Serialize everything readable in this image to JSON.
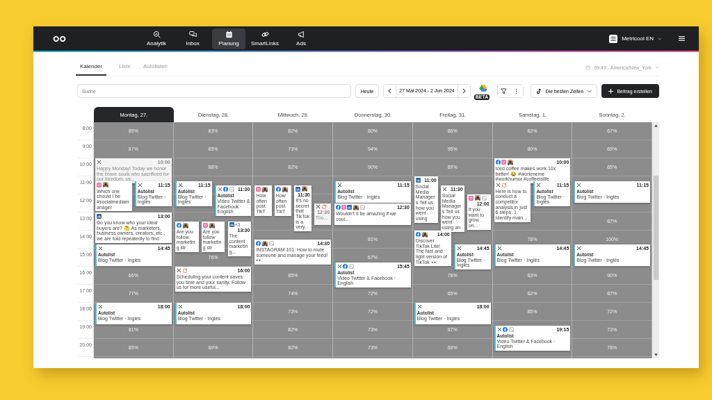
{
  "nav": [
    {
      "label": "Analytik",
      "kind": "analytics",
      "selected": false
    },
    {
      "label": "Inbox",
      "kind": "chat",
      "selected": false
    },
    {
      "label": "Planung",
      "kind": "calendar",
      "selected": true
    },
    {
      "label": "SmartLinks",
      "kind": "link",
      "selected": false
    },
    {
      "label": "Ads",
      "kind": "megaphone",
      "selected": false
    }
  ],
  "account": {
    "name": "Metricool EN"
  },
  "tabs": [
    {
      "label": "Kalender",
      "selected": true
    },
    {
      "label": "Liste",
      "selected": false
    },
    {
      "label": "Autolisten",
      "selected": false
    }
  ],
  "clock": "09:49 - America/New_York",
  "search": {
    "placeholder": "Suche"
  },
  "today_button": "Heute",
  "date_range": "27 Mai 2024 - 2 Jun 2024",
  "beta_badge": "BETA",
  "best_times": "Die besten Zeiten",
  "create_button": "Beitrag erstellen",
  "hours": [
    "8:00",
    "9:00",
    "10:00",
    "11:00",
    "12:00",
    "13:00",
    "14:00",
    "15:00",
    "16:00",
    "17:00",
    "18:00",
    "19:00",
    "20:00"
  ],
  "days": [
    {
      "label": "Montag, 27.",
      "selected": true,
      "heat": [
        {
          "value": "85%"
        },
        {
          "value": "87%"
        },
        {
          "covered": true
        },
        {
          "covered": true
        },
        {
          "covered": true
        },
        {
          "covered": true
        },
        {
          "covered": true
        },
        {
          "covered": true
        },
        {
          "value": "66%"
        },
        {
          "value": "77%"
        },
        {
          "covered": true
        },
        {
          "value": "81%"
        },
        {
          "value": "85%"
        }
      ],
      "posts": [
        {
          "networks": [
            {
              "kind": "x"
            }
          ],
          "time": "10:00",
          "text": "Happy Monday! Today we honor the brave souls who sacrificed for our freedom. us...",
          "past": true
        },
        {
          "networks": [
            {
              "kind": "instagram"
            }
          ],
          "text": "Which one should I be #socialmediamanager",
          "thumb": true,
          "past": false
        },
        {
          "networks": [
            {
              "kind": "x"
            }
          ],
          "time": "11:15",
          "autolist": "Autolist",
          "text": "Blog Twitter · Inglés",
          "past": false
        },
        {
          "networks": [
            {
              "kind": "linkedin"
            }
          ],
          "time": "13:00",
          "text": "Do you know who your ideal buyers are? 🤔 As marketers, business owners, creators, etc., we are told repeatedly to find",
          "past": false
        },
        {
          "networks": [
            {
              "kind": "x"
            }
          ],
          "time": "14:45",
          "autolist": "Autolist",
          "text": "Blog Twitter · Inglés",
          "past": false
        },
        {
          "networks": [
            {
              "kind": "x"
            }
          ],
          "time": "18:00",
          "autolist": "Autolist",
          "text": "Blog Twitter · Inglés",
          "past": false
        }
      ]
    },
    {
      "label": "Dienstag, 28.",
      "selected": false,
      "heat": [
        {
          "value": "83%"
        },
        {
          "value": "85%"
        },
        {
          "value": "88%"
        },
        {
          "covered": true
        },
        {
          "covered": true
        },
        {
          "covered": true
        },
        {
          "covered": true
        },
        {
          "value": "76%"
        },
        {
          "covered": true
        },
        {
          "covered": true
        },
        {
          "covered": true
        },
        {
          "covered": true
        },
        {
          "value": "60%"
        }
      ],
      "posts": [
        {
          "networks": [
            {
              "kind": "x"
            }
          ],
          "time": "11:15",
          "autolist": "Autolist",
          "text": "Blog Twitter · Inglés",
          "past": false
        },
        {
          "networks": [
            {
              "kind": "x"
            },
            {
              "kind": "facebook"
            }
          ],
          "time": "11:30",
          "autolist": "Autolist",
          "text": "Video Twitter & Facebook · English",
          "footer": {
            "kind": "grid"
          },
          "past": false
        },
        {
          "networks": [
            {
              "kind": "facebook"
            }
          ],
          "text": "Are you follow marketing str",
          "thumb": true,
          "past": false
        },
        {
          "networks": [
            {
              "kind": "instagram"
            }
          ],
          "text": "Are you follow marketing str",
          "thumb": true,
          "past": false
        },
        {
          "networks": [
            {
              "kind": "linkedin"
            }
          ],
          "time": "13:30",
          "text": "The content marketing...",
          "extra": "+3",
          "past": false
        },
        {
          "networks": [
            {
              "kind": "x"
            }
          ],
          "time": "16:00",
          "text": "Scheduling your content saves you time and your sanity. Follow us for more useful...",
          "footer": {
            "kind": "edit"
          },
          "past": false
        },
        {
          "networks": [
            {
              "kind": "x"
            }
          ],
          "time": "18:00",
          "autolist": "Autolist",
          "text": "Blog Twitter · Inglés",
          "past": false
        }
      ]
    },
    {
      "label": "Mittwoch, 29.",
      "selected": false,
      "heat": [
        {
          "value": "82%"
        },
        {
          "value": "73%"
        },
        {
          "value": "82%"
        },
        {
          "covered": true
        },
        {
          "covered": true
        },
        {
          "covered": true
        },
        {
          "covered": true
        },
        {
          "covered": true
        },
        {
          "value": "85%"
        },
        {
          "value": "74%"
        },
        {
          "value": "73%"
        },
        {
          "value": "82%"
        },
        {
          "value": "82%"
        }
      ],
      "posts": [
        {
          "networks": [
            {
              "kind": "instagram"
            }
          ],
          "text": "How often post TikT",
          "thumb": true,
          "past": false
        },
        {
          "networks": [
            {
              "kind": "facebook"
            }
          ],
          "text": "How often post TikT",
          "thumb": true,
          "past": false
        },
        {
          "networks": [
            {
              "kind": "linkedin"
            }
          ],
          "time": "11:30",
          "text": "It's no secret that TikTok is a very...",
          "thumb": true,
          "past": false
        },
        {
          "networks": [
            {
              "kind": "x"
            }
          ],
          "time": "12:30",
          "text": "Tho...",
          "past": true,
          "footer": {
            "kind": "edit"
          }
        },
        {
          "networks": [
            {
              "kind": "facebook"
            }
          ],
          "time": "14:30",
          "text": "INSTAGRAM 101: How to mute someone and manage your feed! 👀",
          "thumb": true,
          "footer": {
            "kind": "grid"
          },
          "past": false
        }
      ]
    },
    {
      "label": "Donnerstag, 30.",
      "selected": false,
      "heat": [
        {
          "value": "80%"
        },
        {
          "value": "94%"
        },
        {
          "value": "90%"
        },
        {
          "covered": true
        },
        {
          "covered": true
        },
        {
          "covered": true
        },
        {
          "value": "81%"
        },
        {
          "value": "67%"
        },
        {
          "covered": true
        },
        {
          "value": "72%"
        },
        {
          "value": "72%"
        },
        {
          "value": "73%"
        },
        {
          "value": "73%"
        }
      ],
      "posts": [
        {
          "networks": [
            {
              "kind": "x"
            }
          ],
          "time": "11:15",
          "autolist": "Autolist",
          "text": "Blog Twitter · Inglés",
          "past": false
        },
        {
          "networks": [
            {
              "kind": "facebook"
            },
            {
              "kind": "instagram"
            },
            {
              "kind": "linkedin"
            }
          ],
          "time": "12:30",
          "text": "Wouldn't it be amazing if we coul...",
          "thumb": true,
          "footer": {
            "kind": "grid"
          },
          "past": false
        },
        {
          "networks": [
            {
              "kind": "x"
            },
            {
              "kind": "facebook"
            }
          ],
          "time": "15:45",
          "autolist": "Autolist",
          "text": "Video Twitter & Facebook · English",
          "footer": {
            "kind": "grid"
          },
          "past": false
        }
      ]
    },
    {
      "label": "Freitag, 31.",
      "selected": false,
      "heat": [
        {
          "value": "86%"
        },
        {
          "value": "95%"
        },
        {
          "value": "89%"
        },
        {
          "covered": true
        },
        {
          "covered": true
        },
        {
          "covered": true
        },
        {
          "covered": true
        },
        {
          "covered": true
        },
        {
          "value": "78%"
        },
        {
          "value": "65%"
        },
        {
          "covered": true
        },
        {
          "value": "87%"
        },
        {
          "value": "69%"
        }
      ],
      "posts": [
        {
          "networks": [
            {
              "kind": "linkedin"
            }
          ],
          "time": "11:00",
          "text": "Social Media Managers Tell us how you went using",
          "past": false
        },
        {
          "networks": [
            {
              "kind": "x"
            }
          ],
          "time": "11:30",
          "text": "Social Media Managers Tell us how you went using an",
          "past": false
        },
        {
          "networks": [
            {
              "kind": "instagram"
            }
          ],
          "time": "12:00",
          "text": "If you want to grow on...",
          "thumb": true,
          "footer": {
            "kind": "grid"
          },
          "past": false
        },
        {
          "networks": [
            {
              "kind": "facebook"
            }
          ],
          "time": "14:00",
          "text": "Discover TikTok Lite! The fast and light version of TikTok 👀",
          "thumb": true,
          "past": false
        },
        {
          "networks": [
            {
              "kind": "x"
            }
          ],
          "time": "14:45",
          "autolist": "Autolist",
          "text": "Blog Twitter · Inglés",
          "past": false
        },
        {
          "networks": [
            {
              "kind": "x"
            }
          ],
          "time": "18:00",
          "autolist": "Autolist",
          "text": "Blog Twitter · Inglés",
          "past": false
        }
      ]
    },
    {
      "label": "Samstag, 1.",
      "selected": false,
      "heat": [
        {
          "value": "82%"
        },
        {
          "value": "80%"
        },
        {
          "covered": true
        },
        {
          "covered": true
        },
        {
          "covered": true
        },
        {
          "covered": true
        },
        {
          "value": "78%"
        },
        {
          "covered": true
        },
        {
          "value": "83%"
        },
        {
          "value": "82%"
        },
        {
          "value": "85%"
        },
        {
          "covered": true
        },
        {
          "covered": true
        }
      ],
      "posts": [
        {
          "networks": [
            {
              "kind": "facebook"
            },
            {
              "kind": "instagram"
            }
          ],
          "time": "10:00",
          "text": "Iced coffee makes work 10x better! 😂 #workmeme #workhumor #coffeeislife",
          "thumb": true,
          "past": false
        },
        {
          "networks": [
            {
              "kind": "x"
            }
          ],
          "text": "Here is how to conduct a competitor analysis in just 6 steps: 1. Identify main...",
          "footer": {
            "kind": "edit"
          },
          "past": false
        },
        {
          "networks": [
            {
              "kind": "x"
            }
          ],
          "time": "11:15",
          "autolist": "Autolist",
          "text": "Blog Twitter · Inglés",
          "past": false
        },
        {
          "networks": [
            {
              "kind": "x"
            }
          ],
          "time": "14:45",
          "autolist": "Autolist",
          "text": "Blog Twitter · Inglés",
          "past": false
        },
        {
          "networks": [
            {
              "kind": "x"
            },
            {
              "kind": "facebook"
            }
          ],
          "time": "19:15",
          "autolist": "Autolist",
          "text": "Video Twitter & Facebook · English",
          "footer": {
            "kind": "grid"
          },
          "past": false
        }
      ]
    },
    {
      "label": "Sonntag, 2.",
      "selected": false,
      "heat": [
        {
          "value": "67%"
        },
        {
          "value": "69%"
        },
        {
          "value": "65%"
        },
        {
          "covered": true
        },
        {
          "covered": true
        },
        {
          "value": "87%"
        },
        {
          "value": "100%"
        },
        {
          "covered": true
        },
        {
          "value": "90%"
        },
        {
          "value": "87%"
        },
        {
          "value": "72%"
        },
        {
          "value": "73%"
        },
        {
          "value": "78%"
        }
      ],
      "posts": [
        {
          "networks": [
            {
              "kind": "x"
            }
          ],
          "time": "11:15",
          "autolist": "Autolist",
          "text": "Blog Twitter · Inglés",
          "past": false
        },
        {
          "networks": [
            {
              "kind": "x"
            }
          ],
          "time": "14:45",
          "autolist": "Autolist",
          "text": "Blog Twitter · Inglés",
          "past": false
        }
      ]
    }
  ]
}
